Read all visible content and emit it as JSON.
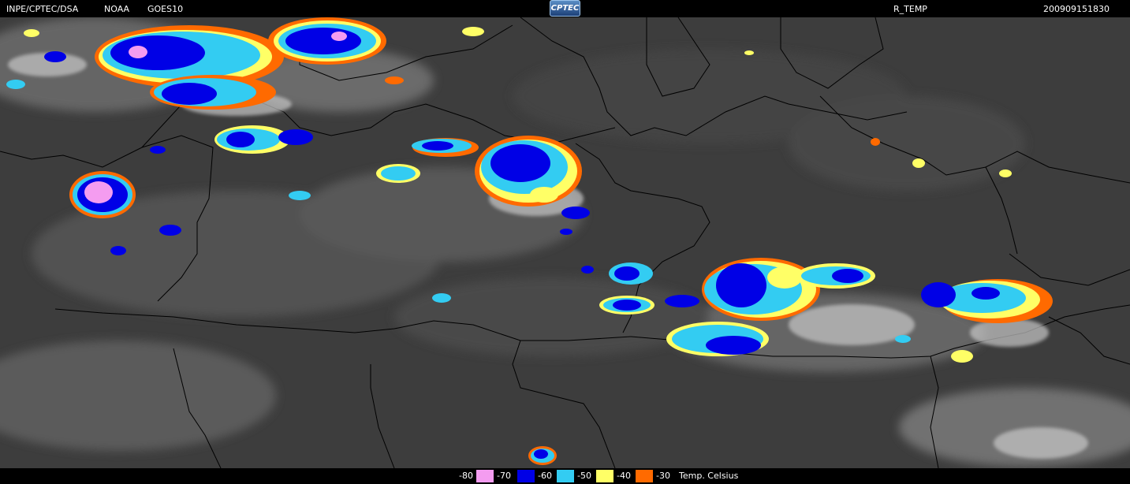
{
  "header": {
    "source": "INPE/CPTEC/DSA",
    "agency": "NOAA",
    "satellite": "GOES10",
    "logo_text": "CPTEC",
    "product": "R_TEMP",
    "timestamp": "200909151830"
  },
  "legend": {
    "entries": [
      {
        "label": "-80",
        "color": "#f49cf0"
      },
      {
        "label": "-70",
        "color": "#0000e6"
      },
      {
        "label": "-60",
        "color": "#33ccf2"
      },
      {
        "label": "-50",
        "color": "#ffff66"
      },
      {
        "label": "-40",
        "color": "#ff6a00"
      },
      {
        "label": "-30",
        "color": ""
      }
    ],
    "unit": "Temp. Celsius"
  },
  "colors": {
    "background_ir": "#3b3b3b",
    "border_lines": "#000000"
  }
}
